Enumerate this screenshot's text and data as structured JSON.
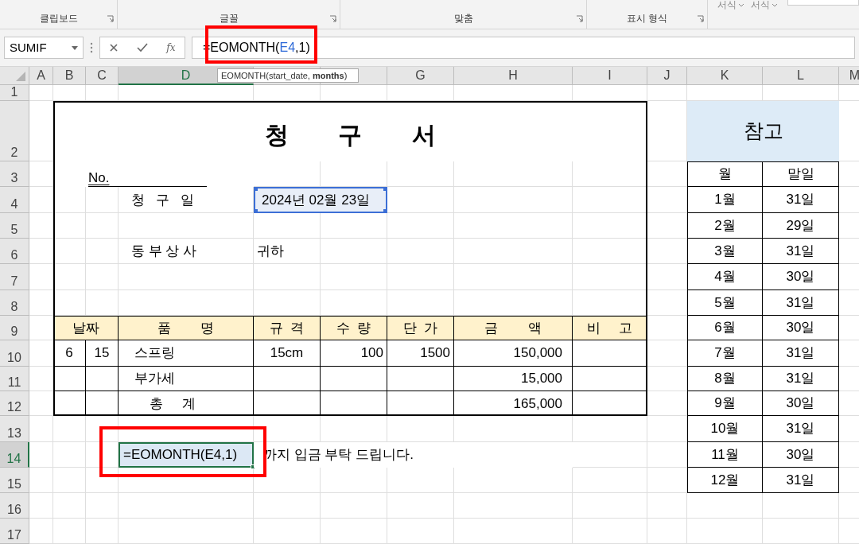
{
  "ribbon": {
    "top_items": [
      "서식",
      "서식"
    ],
    "groups": [
      "클립보드",
      "글꼴",
      "맞춤",
      "표시 형식"
    ]
  },
  "name_box": "SUMIF",
  "formula": {
    "before": "=EOMONTH(",
    "reference": "E4",
    "after": ",1)"
  },
  "function_label": "fx",
  "tooltip": "EOMONTH(start_date, **months**)",
  "columns": [
    {
      "label": "A",
      "selected": false
    },
    {
      "label": "B",
      "selected": false
    },
    {
      "label": "C",
      "selected": false
    },
    {
      "label": "D",
      "selected": true
    },
    {
      "selected": false
    },
    {
      "selected": false
    },
    {
      "label": "G",
      "selected": false
    },
    {
      "label": "H",
      "selected": false
    },
    {
      "label": "I",
      "selected": false
    },
    {
      "label": "J",
      "selected": false
    },
    {
      "label": "K",
      "selected": false
    },
    {
      "label": "L",
      "selected": false
    },
    {
      "label": "M",
      "selected": false
    }
  ],
  "rows": [
    {
      "label": "1",
      "selected": false
    },
    {
      "label": "2",
      "selected": false
    },
    {
      "label": "3",
      "selected": false
    },
    {
      "label": "4",
      "selected": false
    },
    {
      "label": "5",
      "selected": false
    },
    {
      "label": "6",
      "selected": false
    },
    {
      "label": "7",
      "selected": false
    },
    {
      "label": "8",
      "selected": false
    },
    {
      "label": "9",
      "selected": false
    },
    {
      "label": "10",
      "selected": false
    },
    {
      "label": "11",
      "selected": false
    },
    {
      "label": "12",
      "selected": false
    },
    {
      "label": "13",
      "selected": false
    },
    {
      "label": "14",
      "selected": true
    },
    {
      "label": "15",
      "selected": false
    },
    {
      "label": "16",
      "selected": false
    },
    {
      "label": "17",
      "selected": false
    }
  ],
  "invoice": {
    "title": "청 구 서",
    "no_label": "No.",
    "date_label": "청   구   일",
    "date": "2024년 02월 23일",
    "recipient": "동 부 상 사",
    "honorific": "귀하",
    "header": {
      "date": "날짜",
      "item": "품        명",
      "spec": "규  격",
      "qty": "수  량",
      "price": "단  가",
      "amount": "금        액",
      "note": "비     고"
    },
    "rows": [
      {
        "month": "6",
        "day": "15",
        "item": "스프링",
        "spec": "15cm",
        "qty": "100",
        "price": "1500",
        "amount": "150,000"
      },
      {
        "item": "부가세",
        "amount": "15,000"
      },
      {
        "item": "    총     계",
        "amount": "165,000"
      }
    ],
    "closing_formula": "=EOMONTH(E4,1)",
    "closing_text": "까지 입금 부탁 드립니다."
  },
  "reference": {
    "title": "참고",
    "columns": [
      "월",
      "말일"
    ],
    "rows": [
      [
        "1월",
        "31일"
      ],
      [
        "2월",
        "29일"
      ],
      [
        "3월",
        "31일"
      ],
      [
        "4월",
        "30일"
      ],
      [
        "5월",
        "31일"
      ],
      [
        "6월",
        "30일"
      ],
      [
        "7월",
        "31일"
      ],
      [
        "8월",
        "31일"
      ],
      [
        "9월",
        "30일"
      ],
      [
        "10월",
        "31일"
      ],
      [
        "11월",
        "30일"
      ],
      [
        "12월",
        "31일"
      ]
    ]
  }
}
